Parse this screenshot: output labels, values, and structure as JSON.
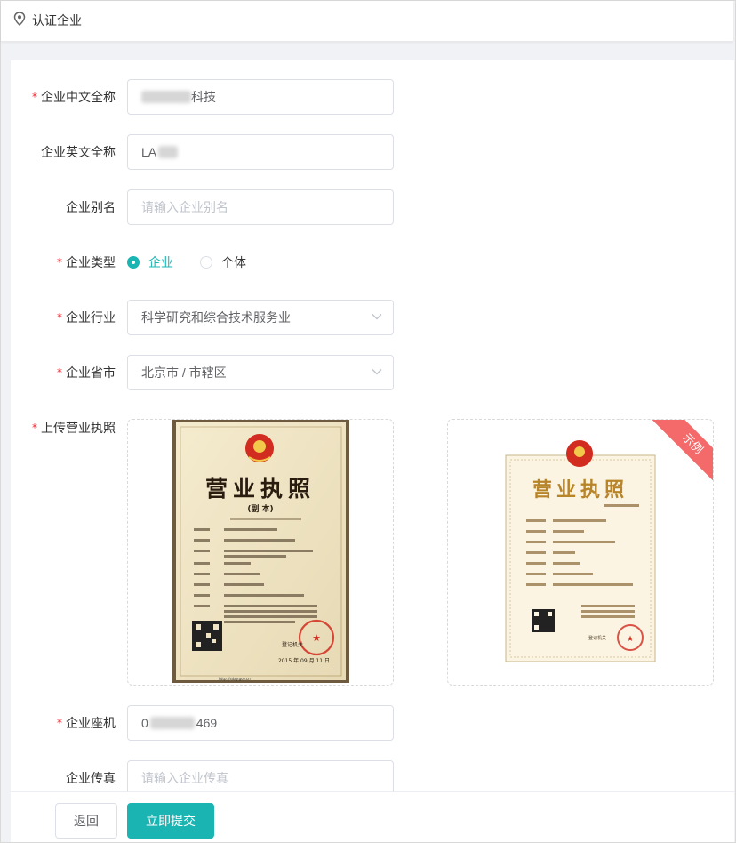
{
  "header": {
    "title": "认证企业",
    "icon": "location-pin-icon"
  },
  "form": {
    "required_mark": "*",
    "cn_name": {
      "label": "企业中文全称",
      "value_visible": "科技",
      "required": true
    },
    "en_name": {
      "label": "企业英文全称",
      "value_visible": "LA",
      "required": false
    },
    "alias": {
      "label": "企业别名",
      "placeholder": "请输入企业别名",
      "required": false
    },
    "type": {
      "label": "企业类型",
      "options": [
        "企业",
        "个体"
      ],
      "selected": "企业",
      "required": true
    },
    "industry": {
      "label": "企业行业",
      "value": "科学研究和综合技术服务业",
      "required": true
    },
    "province": {
      "label": "企业省市",
      "value": "北京市 / 市辖区",
      "required": true
    },
    "license": {
      "label": "上传营业执照",
      "required": true,
      "uploaded_image": {
        "title": "营业执照",
        "subtitle": "(副 本)",
        "authority": "登记机关",
        "date": "2015 年 09 月 11 日",
        "url": "http://sday.gov.cn"
      },
      "example_image": {
        "badge": "示例",
        "title": "营业执照",
        "authority": "登记机关"
      }
    },
    "phone": {
      "label": "企业座机",
      "value_prefix": "0",
      "value_suffix": "469",
      "required": true
    },
    "fax": {
      "label": "企业传真",
      "placeholder": "请输入企业传真",
      "required": false
    }
  },
  "footer": {
    "back_label": "返回",
    "submit_label": "立即提交"
  },
  "colors": {
    "accent": "#1ab5b3",
    "required": "#f5222d",
    "ribbon": "#f46a6a"
  }
}
